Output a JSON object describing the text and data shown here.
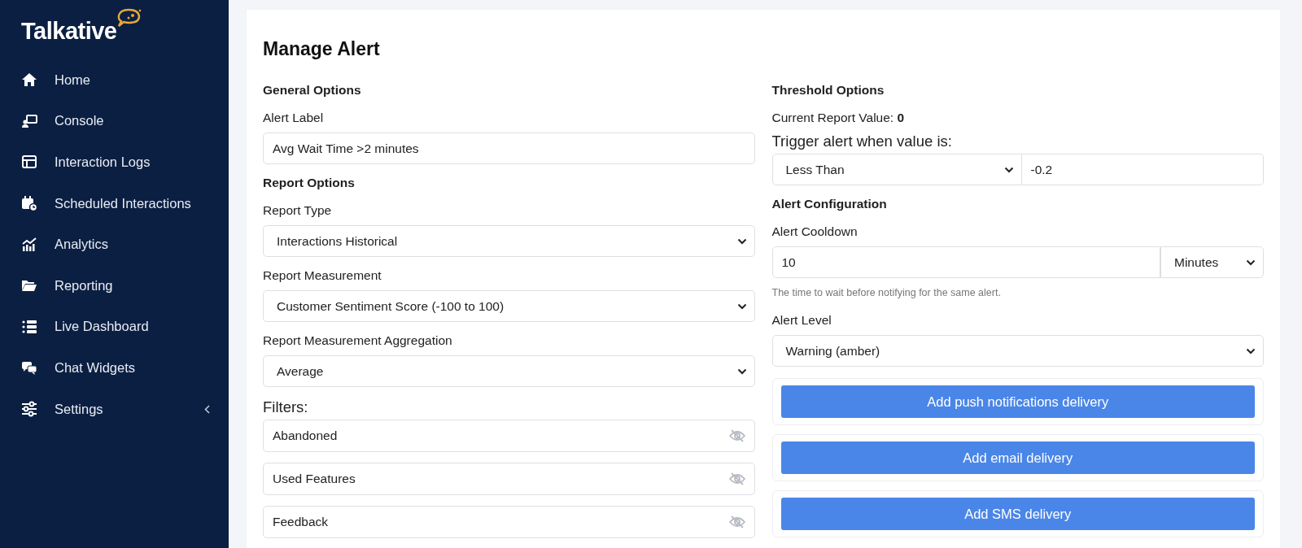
{
  "sidebar": {
    "logo": "Talkative",
    "items": [
      {
        "label": "Home",
        "expandable": false
      },
      {
        "label": "Console",
        "expandable": false
      },
      {
        "label": "Interaction Logs",
        "expandable": false
      },
      {
        "label": "Scheduled Interactions",
        "expandable": false
      },
      {
        "label": "Analytics",
        "expandable": false
      },
      {
        "label": "Reporting",
        "expandable": false
      },
      {
        "label": "Live Dashboard",
        "expandable": false
      },
      {
        "label": "Chat Widgets",
        "expandable": false
      },
      {
        "label": "Settings",
        "expandable": true
      }
    ]
  },
  "page": {
    "title": "Manage Alert",
    "left": [
      {
        "kind": "heading",
        "text": "General Options"
      },
      {
        "kind": "label",
        "text": "Alert Label"
      },
      {
        "kind": "input",
        "value": "Avg Wait Time >2 minutes"
      },
      {
        "kind": "heading",
        "text": "Report Options"
      },
      {
        "kind": "label",
        "text": "Report Type"
      },
      {
        "kind": "select",
        "value": "Interactions Historical"
      },
      {
        "kind": "label",
        "text": "Report Measurement"
      },
      {
        "kind": "select",
        "value": "Customer Sentiment Score (-100 to 100)"
      },
      {
        "kind": "label",
        "text": "Report Measurement Aggregation"
      },
      {
        "kind": "select",
        "value": "Average"
      },
      {
        "kind": "biglabel",
        "text": "Filters:"
      },
      {
        "kind": "filter",
        "value": "Abandoned"
      },
      {
        "kind": "filter",
        "value": "Used Features"
      },
      {
        "kind": "filter",
        "value": "Feedback"
      }
    ],
    "right": [
      {
        "kind": "heading",
        "text": "Threshold Options"
      },
      {
        "kind": "richtext",
        "text": "Current Report Value: **0**"
      },
      {
        "kind": "biglabel",
        "text": "Trigger alert when value is:"
      },
      {
        "kind": "select-input",
        "select": "Less Than",
        "value": "-0.2"
      },
      {
        "kind": "heading",
        "text": "Alert Configuration"
      },
      {
        "kind": "label",
        "text": "Alert Cooldown"
      },
      {
        "kind": "input-select",
        "value": "10",
        "select": "Minutes"
      },
      {
        "kind": "help",
        "text": "The time to wait before notifying for the same alert."
      },
      {
        "kind": "label",
        "text": "Alert Level"
      },
      {
        "kind": "select",
        "value": "Warning (amber)"
      },
      {
        "kind": "delivery",
        "text": "Add push notifications delivery"
      },
      {
        "kind": "delivery",
        "text": "Add email delivery"
      },
      {
        "kind": "delivery",
        "text": "Add SMS delivery"
      }
    ]
  }
}
